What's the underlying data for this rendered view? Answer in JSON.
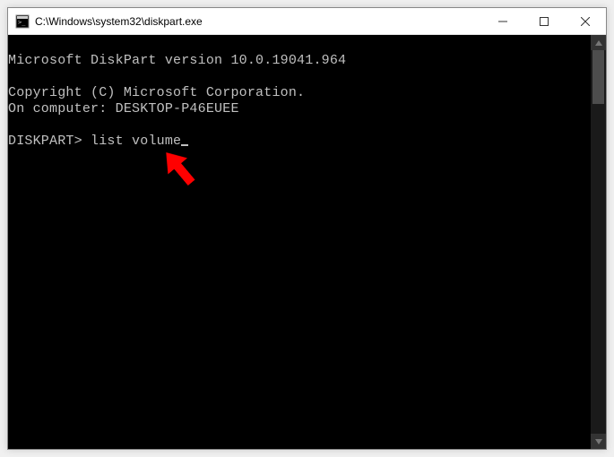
{
  "window": {
    "title": "C:\\Windows\\system32\\diskpart.exe"
  },
  "console": {
    "lines": [
      "",
      "Microsoft DiskPart version 10.0.19041.964",
      "",
      "Copyright (C) Microsoft Corporation.",
      "On computer: DESKTOP-P46EUEE",
      ""
    ],
    "prompt": "DISKPART>",
    "command": "list volume"
  }
}
